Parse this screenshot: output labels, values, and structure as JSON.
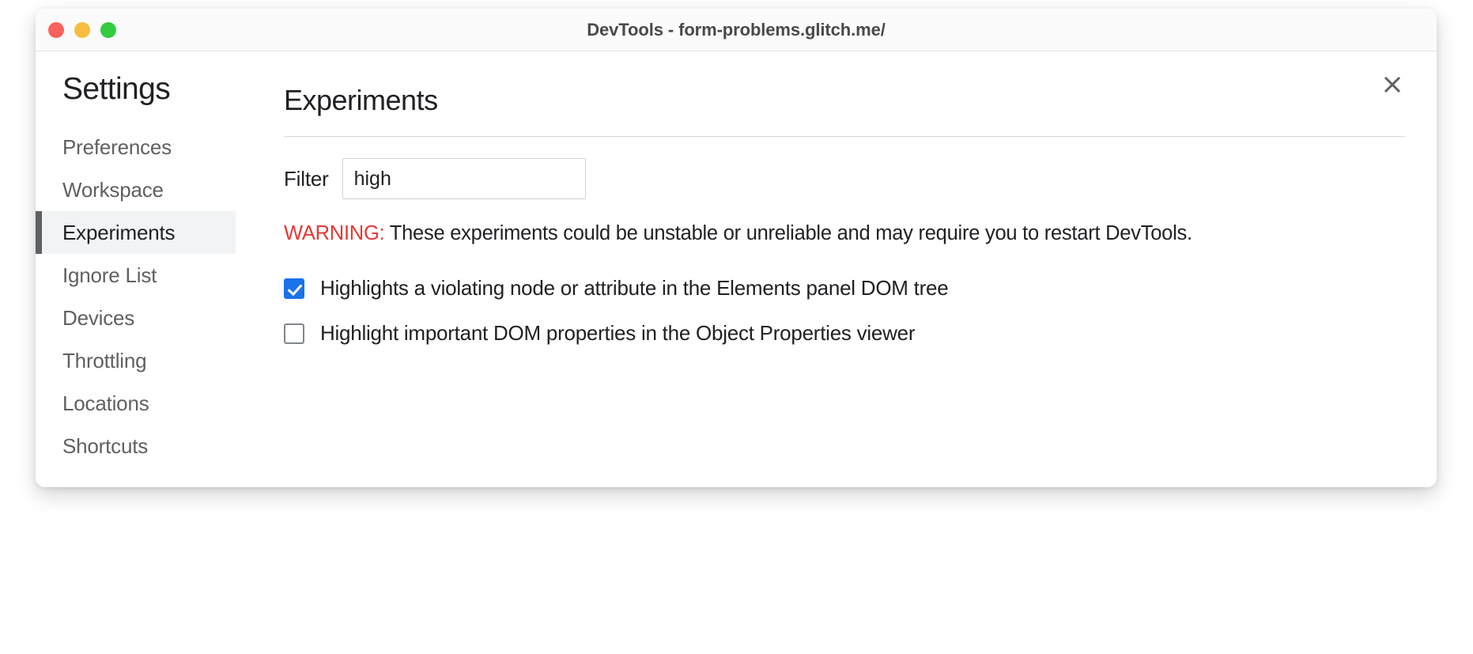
{
  "window": {
    "title": "DevTools - form-problems.glitch.me/",
    "traffic_lights": [
      {
        "name": "close",
        "color": "#f9625c"
      },
      {
        "name": "minimize",
        "color": "#f8bd40"
      },
      {
        "name": "maximize",
        "color": "#32cd3e"
      }
    ]
  },
  "sidebar": {
    "title": "Settings",
    "items": [
      {
        "label": "Preferences",
        "selected": false
      },
      {
        "label": "Workspace",
        "selected": false
      },
      {
        "label": "Experiments",
        "selected": true
      },
      {
        "label": "Ignore List",
        "selected": false
      },
      {
        "label": "Devices",
        "selected": false
      },
      {
        "label": "Throttling",
        "selected": false
      },
      {
        "label": "Locations",
        "selected": false
      },
      {
        "label": "Shortcuts",
        "selected": false
      }
    ]
  },
  "content": {
    "title": "Experiments",
    "close_icon": "close-icon",
    "filter": {
      "label": "Filter",
      "value": "high",
      "placeholder": ""
    },
    "warning": {
      "label": "WARNING:",
      "text": "These experiments could be unstable or unreliable and may require you to restart DevTools.",
      "color": "#e53935"
    },
    "experiments": [
      {
        "label": "Highlights a violating node or attribute in the Elements panel DOM tree",
        "checked": true
      },
      {
        "label": "Highlight important DOM properties in the Object Properties viewer",
        "checked": false
      }
    ]
  },
  "colors": {
    "accent": "#1a73e8",
    "selected_bar": "#5f6063",
    "selected_bg": "#f1f3f4",
    "warning": "#e53935"
  }
}
